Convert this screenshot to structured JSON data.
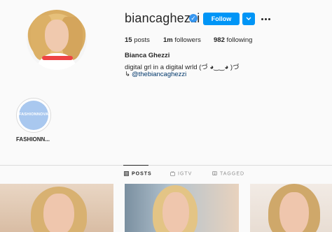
{
  "profile": {
    "username": "biancaghezzi",
    "follow_label": "Follow",
    "posts_count": "15",
    "posts_label": "posts",
    "followers_count": "1m",
    "followers_label": "followers",
    "following_count": "982",
    "following_label": "following",
    "full_name": "Bianca Ghezzi",
    "bio": "digital grl in a digital wrld (づ ◕‿‿◕ )づ",
    "link_arrow": "↳",
    "link": "@thebiancaghezzi"
  },
  "highlights": [
    {
      "logo_text": "FASHIONNOVA",
      "label": "FASHIONN..."
    }
  ],
  "tabs": [
    {
      "label": "POSTS",
      "icon": "grid-icon",
      "active": true
    },
    {
      "label": "IGTV",
      "icon": "igtv-icon",
      "active": false
    },
    {
      "label": "TAGGED",
      "icon": "tag-icon",
      "active": false
    }
  ],
  "colors": {
    "accent": "#0095f6",
    "verified": "#3897f0",
    "link": "#00376b",
    "background": "#fafafa"
  }
}
